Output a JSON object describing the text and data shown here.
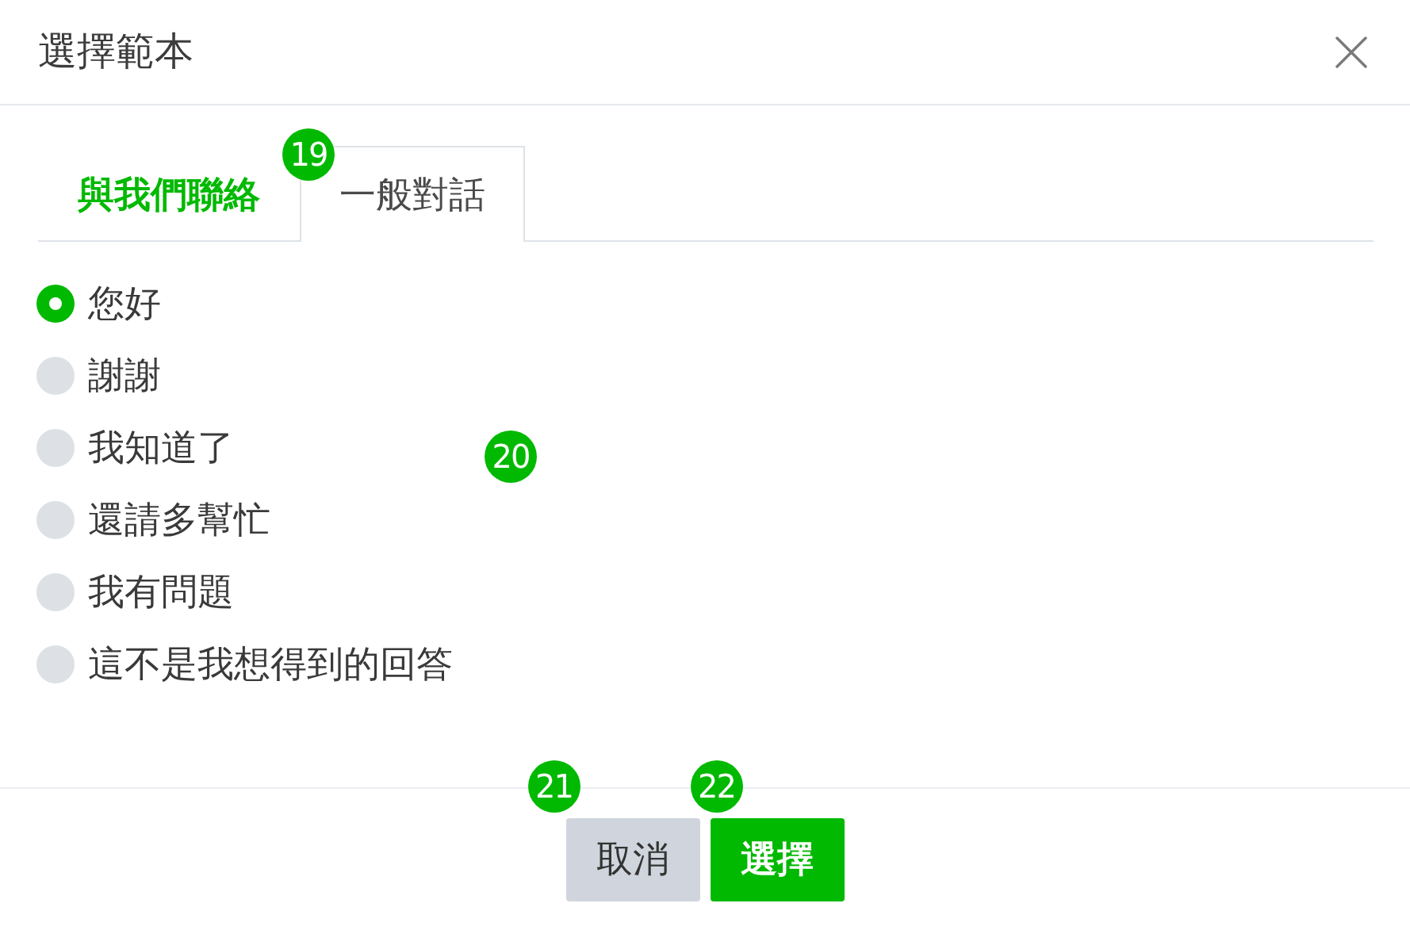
{
  "dialog": {
    "title": "選擇範本"
  },
  "tabs": [
    {
      "label": "與我們聯絡",
      "selected": false
    },
    {
      "label": "一般對話",
      "selected": true,
      "badge": "19"
    }
  ],
  "options": {
    "badge": "20",
    "items": [
      {
        "label": "您好",
        "selected": true
      },
      {
        "label": "謝謝",
        "selected": false
      },
      {
        "label": "我知道了",
        "selected": false
      },
      {
        "label": "還請多幫忙",
        "selected": false
      },
      {
        "label": "我有問題",
        "selected": false
      },
      {
        "label": "這不是我想得到的回答",
        "selected": false
      }
    ]
  },
  "buttons": [
    {
      "label": "取消",
      "kind": "secondary",
      "badge": "21"
    },
    {
      "label": "選擇",
      "kind": "primary",
      "badge": "22"
    }
  ]
}
